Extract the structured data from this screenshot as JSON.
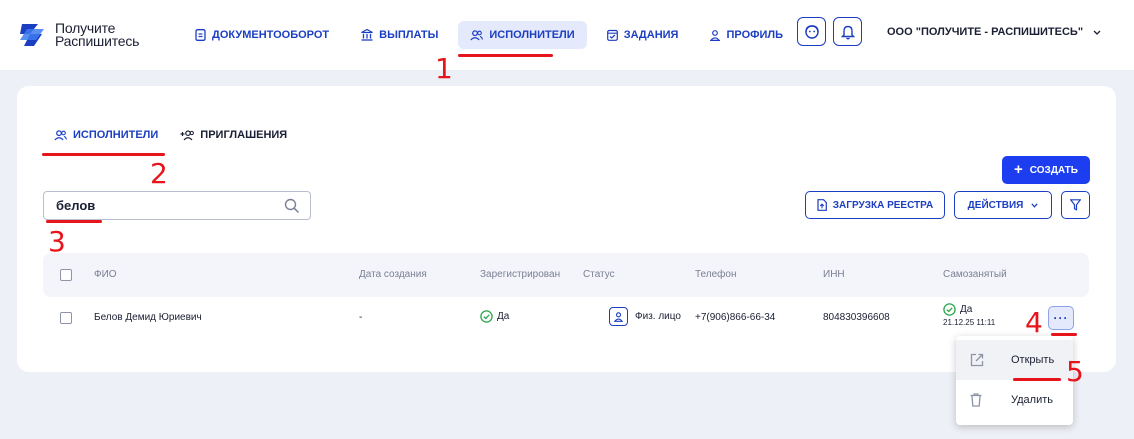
{
  "brand": {
    "line1": "Получите",
    "line2": "Распишитесь"
  },
  "nav": {
    "items": [
      {
        "label": "ДОКУМЕНТООБОРОТ",
        "icon": "document-icon"
      },
      {
        "label": "ВЫПЛАТЫ",
        "icon": "bank-icon"
      },
      {
        "label": "ИСПОЛНИТЕЛИ",
        "icon": "users-icon",
        "active": true
      },
      {
        "label": "ЗАДАНИЯ",
        "icon": "task-icon"
      },
      {
        "label": "ПРОФИЛЬ",
        "icon": "user-icon"
      }
    ]
  },
  "header": {
    "org_name": "ООО \"ПОЛУЧИТЕ - РАСПИШИТЕСЬ\""
  },
  "tabs": [
    {
      "label": "ИСПОЛНИТЕЛИ",
      "active": true
    },
    {
      "label": "ПРИГЛАШЕНИЯ",
      "active": false
    }
  ],
  "search": {
    "value": "белов"
  },
  "buttons": {
    "create": "СОЗДАТЬ",
    "upload": "ЗАГРУЗКА РЕЕСТРА",
    "actions": "ДЕЙСТВИЯ",
    "more": "···"
  },
  "table": {
    "columns": [
      "ФИО",
      "Дата создания",
      "Зарегистрирован",
      "Статус",
      "Телефон",
      "ИНН",
      "Самозанятый"
    ],
    "rows": [
      {
        "name": "Белов Демид Юриевич",
        "created": "-",
        "registered": "Да",
        "status": "Физ. лицо",
        "phone": "+7(906)866-66-34",
        "inn": "804830396608",
        "self_employed": "Да",
        "self_employed_date": "21.12.25 11:11"
      }
    ]
  },
  "menu": {
    "open": "Открыть",
    "delete": "Удалить"
  },
  "annotations": [
    "1",
    "2",
    "3",
    "4",
    "5"
  ],
  "colors": {
    "accent": "#1c3ef0",
    "annotation": "#e8141b",
    "success": "#2aa84a"
  }
}
